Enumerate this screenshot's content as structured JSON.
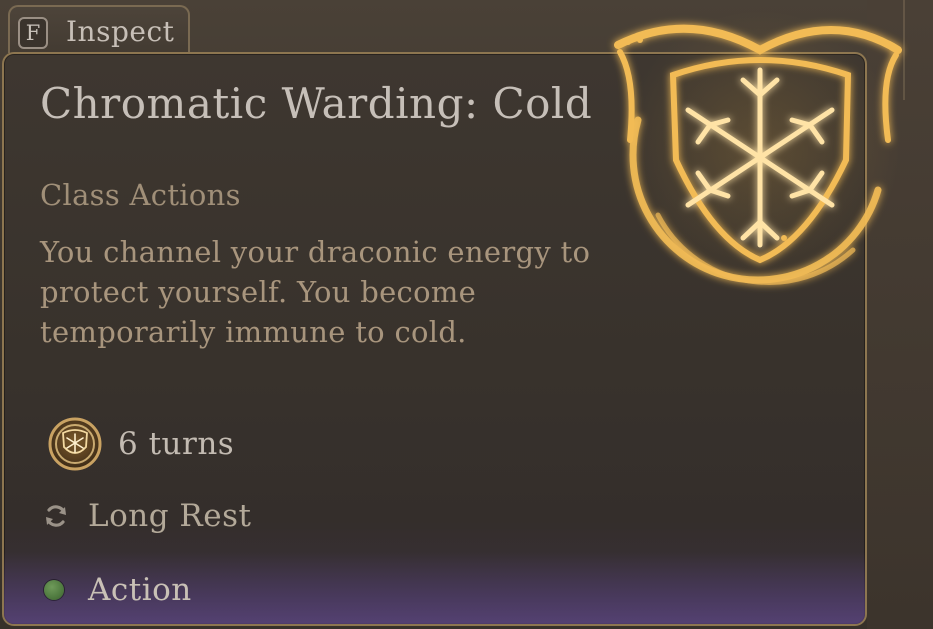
{
  "inspect_tab": {
    "key": "F",
    "label": "Inspect"
  },
  "tooltip": {
    "title": "Chromatic Warding: Cold",
    "subtitle": "Class Actions",
    "description": "You channel your draconic energy to protect yourself. You become temporarily immune to cold.",
    "duration": {
      "icon": "snowflake-shield-icon",
      "text": "6 turns"
    },
    "recharge": {
      "icon": "refresh-icon",
      "text": "Long Rest"
    },
    "cost": {
      "icon": "action-dot-icon",
      "text": "Action"
    },
    "emblem_icon": "chromatic-warding-cold-emblem"
  },
  "colors": {
    "panel_border": "#8d7650",
    "title_text": "#c6bfb8",
    "subtitle_text": "#a08f78",
    "action_dot": "#5a8a48",
    "emblem_glow": "#f0b64a",
    "footer_tint": "#5c4682"
  }
}
